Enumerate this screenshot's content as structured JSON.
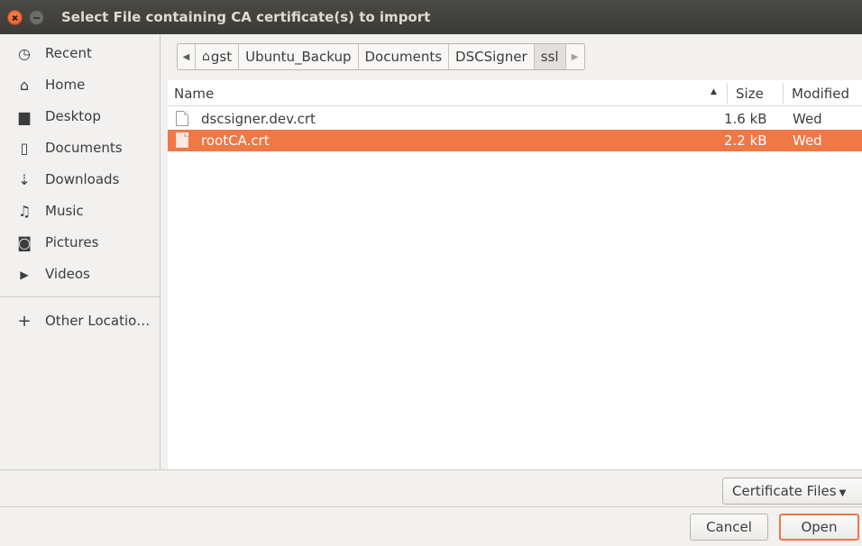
{
  "window": {
    "title": "Select File containing CA certificate(s) to import"
  },
  "sidebar": {
    "items": [
      {
        "label": "Recent",
        "icon": "clock-icon",
        "glyph": "◷"
      },
      {
        "label": "Home",
        "icon": "home-icon",
        "glyph": "⌂"
      },
      {
        "label": "Desktop",
        "icon": "folder-icon",
        "glyph": "▆"
      },
      {
        "label": "Documents",
        "icon": "document-icon",
        "glyph": "▯"
      },
      {
        "label": "Downloads",
        "icon": "download-icon",
        "glyph": "⇣"
      },
      {
        "label": "Music",
        "icon": "music-icon",
        "glyph": "♫"
      },
      {
        "label": "Pictures",
        "icon": "camera-icon",
        "glyph": "◙"
      },
      {
        "label": "Videos",
        "icon": "video-icon",
        "glyph": "▶"
      }
    ],
    "other_locations": {
      "label": "Other Locatio…",
      "icon": "plus-icon",
      "glyph": "+"
    }
  },
  "pathbar": {
    "back_glyph": "◀",
    "forward_glyph": "▶",
    "home_glyph": "⌂",
    "crumbs": [
      "gst",
      "Ubuntu_Backup",
      "Documents",
      "DSCSigner",
      "ssl"
    ]
  },
  "filelist": {
    "columns": {
      "name": "Name",
      "size": "Size",
      "modified": "Modified"
    },
    "sort_glyph": "▲",
    "rows": [
      {
        "name": "dscsigner.dev.crt",
        "size": "1.6 kB",
        "modified": "Wed",
        "selected": false
      },
      {
        "name": "rootCA.crt",
        "size": "2.2 kB",
        "modified": "Wed",
        "selected": true
      }
    ]
  },
  "filter": {
    "label": "Certificate Files",
    "caret": "▼"
  },
  "actions": {
    "cancel": "Cancel",
    "open": "Open"
  },
  "colors": {
    "accent": "#f07746",
    "titlebar": "#3c3b37"
  }
}
